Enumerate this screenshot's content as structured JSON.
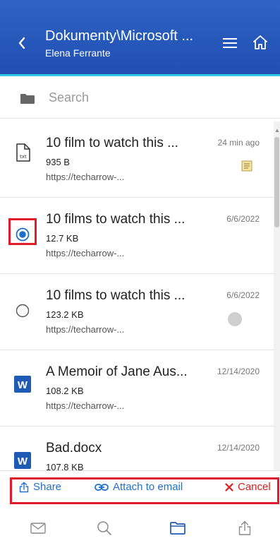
{
  "header": {
    "title": "Dokumenty\\Microsoft ...",
    "subtitle": "Elena Ferrante",
    "back_icon": "chevron-left-icon",
    "menu_icon": "hamburger-menu-icon",
    "home_icon": "home-icon",
    "bg_color": "#2a5bbf",
    "accent_color": "#32c9e6"
  },
  "search": {
    "placeholder": "Search",
    "icon": "folder-icon"
  },
  "items": [
    {
      "title": "10 film to watch this ...",
      "size": "935 B",
      "url": "https://techarrow-...",
      "date": "24 min ago",
      "lead": "txt-file-icon",
      "badge": "note-icon"
    },
    {
      "title": "10 films to watch this ...",
      "size": "12.7 KB",
      "url": "https://techarrow-...",
      "date": "6/6/2022",
      "lead": "radio-selected",
      "badge": ""
    },
    {
      "title": "10 films to watch this ...",
      "size": "123.2 KB",
      "url": "https://techarrow-...",
      "date": "6/6/2022",
      "lead": "radio-unselected",
      "badge": "gray-dot"
    },
    {
      "title": "A Memoir of Jane Aus...",
      "size": "108.2 KB",
      "url": "https://techarrow-...",
      "date": "12/14/2020",
      "lead": "word-icon",
      "badge": ""
    },
    {
      "title": "Bad.docx",
      "size": "107.8 KB",
      "url": "",
      "date": "12/14/2020",
      "lead": "word-icon",
      "badge": ""
    }
  ],
  "actions": {
    "share": "Share",
    "attach": "Attach to email",
    "cancel": "Cancel",
    "link_color": "#1f6fcf",
    "cancel_color": "#e11b1b"
  },
  "bottom_nav": [
    "mail-icon",
    "search-icon",
    "folder-icon",
    "share-icon"
  ]
}
